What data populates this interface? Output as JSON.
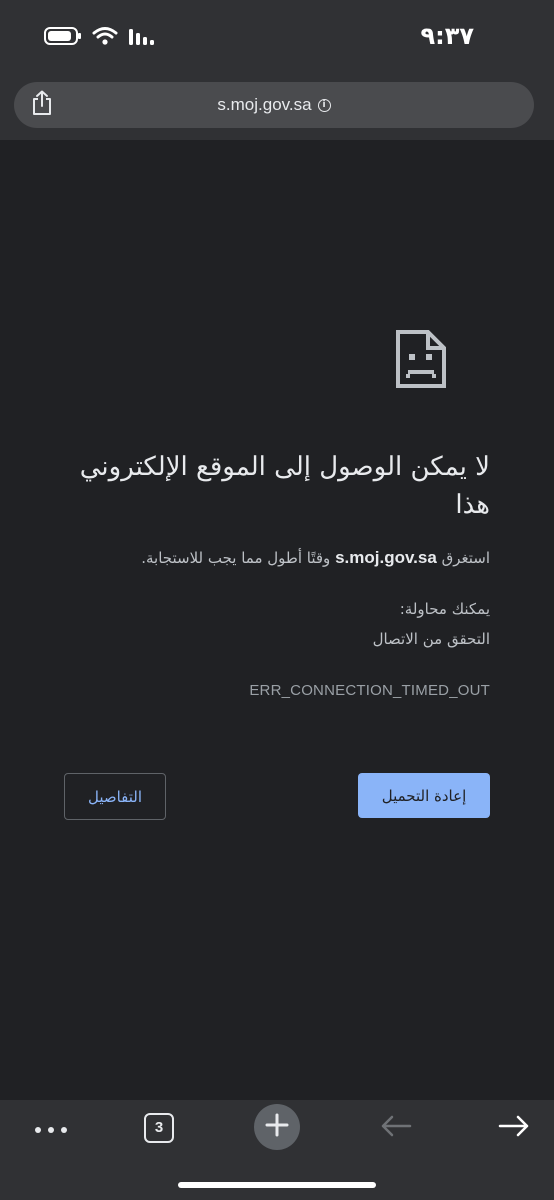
{
  "status_bar": {
    "time": "٩:٣٧",
    "icons": [
      "battery-icon",
      "wifi-icon",
      "signal-icon"
    ]
  },
  "toolbar": {
    "url": "s.moj.gov.sa",
    "share_icon": "share-icon",
    "info_icon": "info-icon"
  },
  "error_page": {
    "icon": "sad-page-icon",
    "heading": "لا يمكن الوصول إلى الموقع الإلكتروني هذا",
    "desc_prefix": "استغرق",
    "host": "s.moj.gov.sa",
    "desc_suffix": "وقتًا أطول مما يجب للاستجابة.",
    "try_label": "يمكنك محاولة:",
    "try_item": "التحقق من الاتصال",
    "error_code": "ERR_CONNECTION_TIMED_OUT",
    "reload_label": "إعادة التحميل",
    "details_label": "التفاصيل"
  },
  "bottom_bar": {
    "tab_count": "3",
    "icons": [
      "more-icon",
      "tab-switcher-icon",
      "plus-icon",
      "back-arrow-icon",
      "forward-arrow-icon"
    ]
  },
  "colors": {
    "background": "#202124",
    "toolbar": "#303134",
    "accent": "#8ab4f8",
    "text": "#e8eaed",
    "secondary_text": "#bdc1c6"
  }
}
